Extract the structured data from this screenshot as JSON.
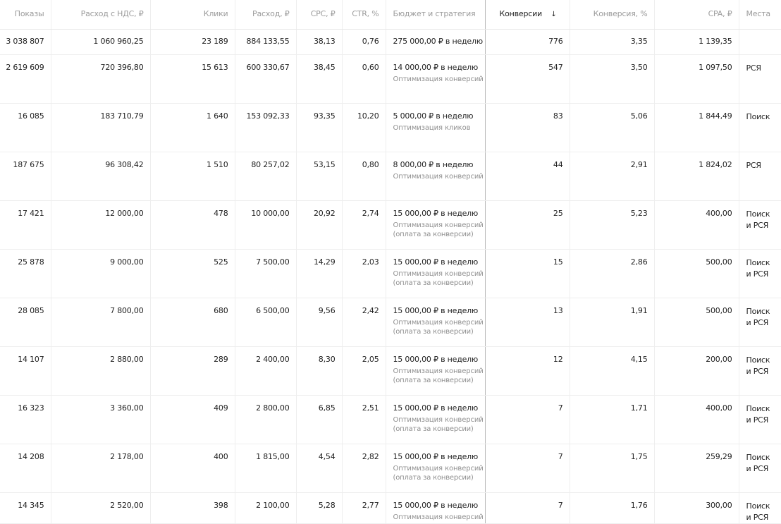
{
  "columns": [
    {
      "key": "impressions",
      "label": "Показы"
    },
    {
      "key": "cost_vat",
      "label": "Расход с НДС, ₽"
    },
    {
      "key": "clicks",
      "label": "Клики"
    },
    {
      "key": "cost",
      "label": "Расход, ₽"
    },
    {
      "key": "cpc",
      "label": "CPC, ₽"
    },
    {
      "key": "ctr",
      "label": "CTR, %"
    },
    {
      "key": "budget",
      "label": "Бюджет и стратегия"
    },
    {
      "key": "conversions",
      "label": "Конверсии",
      "sort_icon": "↓"
    },
    {
      "key": "conv_rate",
      "label": "Конверсия, %"
    },
    {
      "key": "cpa",
      "label": "CPA, ₽"
    },
    {
      "key": "places",
      "label": "Места"
    }
  ],
  "total": {
    "impressions": "3 038 807",
    "cost_vat": "1 060 960,25",
    "clicks": "23 189",
    "cost": "884 133,55",
    "cpc": "38,13",
    "ctr": "0,76",
    "budget": "275 000,00 ₽ в неделю",
    "conversions": "776",
    "conv_rate": "3,35",
    "cpa": "1 139,35"
  },
  "rows": [
    {
      "impressions": "2 619 609",
      "cost_vat": "720 396,80",
      "clicks": "15 613",
      "cost": "600 330,67",
      "cpc": "38,45",
      "ctr": "0,60",
      "budget": "14 000,00 ₽ в неделю",
      "strategy": "Оптимизация конверсий",
      "strategy_note": "",
      "conversions": "547",
      "conv_rate": "3,50",
      "cpa": "1 097,50",
      "places_1": "РСЯ",
      "places_2": ""
    },
    {
      "impressions": "16 085",
      "cost_vat": "183 710,79",
      "clicks": "1 640",
      "cost": "153 092,33",
      "cpc": "93,35",
      "ctr": "10,20",
      "budget": "5 000,00 ₽ в неделю",
      "strategy": "Оптимизация кликов",
      "strategy_note": "",
      "conversions": "83",
      "conv_rate": "5,06",
      "cpa": "1 844,49",
      "places_1": "Поиск",
      "places_2": ""
    },
    {
      "impressions": "187 675",
      "cost_vat": "96 308,42",
      "clicks": "1 510",
      "cost": "80 257,02",
      "cpc": "53,15",
      "ctr": "0,80",
      "budget": "8 000,00 ₽ в неделю",
      "strategy": "Оптимизация конверсий",
      "strategy_note": "",
      "conversions": "44",
      "conv_rate": "2,91",
      "cpa": "1 824,02",
      "places_1": "РСЯ",
      "places_2": ""
    },
    {
      "impressions": "17 421",
      "cost_vat": "12 000,00",
      "clicks": "478",
      "cost": "10 000,00",
      "cpc": "20,92",
      "ctr": "2,74",
      "budget": "15 000,00 ₽ в неделю",
      "strategy": "Оптимизация конверсий",
      "strategy_note": "(оплата за конверсии)",
      "conversions": "25",
      "conv_rate": "5,23",
      "cpa": "400,00",
      "places_1": "Поиск",
      "places_2": "и РСЯ"
    },
    {
      "impressions": "25 878",
      "cost_vat": "9 000,00",
      "clicks": "525",
      "cost": "7 500,00",
      "cpc": "14,29",
      "ctr": "2,03",
      "budget": "15 000,00 ₽ в неделю",
      "strategy": "Оптимизация конверсий",
      "strategy_note": "(оплата за конверсии)",
      "conversions": "15",
      "conv_rate": "2,86",
      "cpa": "500,00",
      "places_1": "Поиск",
      "places_2": "и РСЯ"
    },
    {
      "impressions": "28 085",
      "cost_vat": "7 800,00",
      "clicks": "680",
      "cost": "6 500,00",
      "cpc": "9,56",
      "ctr": "2,42",
      "budget": "15 000,00 ₽ в неделю",
      "strategy": "Оптимизация конверсий",
      "strategy_note": "(оплата за конверсии)",
      "conversions": "13",
      "conv_rate": "1,91",
      "cpa": "500,00",
      "places_1": "Поиск",
      "places_2": "и РСЯ"
    },
    {
      "impressions": "14 107",
      "cost_vat": "2 880,00",
      "clicks": "289",
      "cost": "2 400,00",
      "cpc": "8,30",
      "ctr": "2,05",
      "budget": "15 000,00 ₽ в неделю",
      "strategy": "Оптимизация конверсий",
      "strategy_note": "(оплата за конверсии)",
      "conversions": "12",
      "conv_rate": "4,15",
      "cpa": "200,00",
      "places_1": "Поиск",
      "places_2": "и РСЯ"
    },
    {
      "impressions": "16 323",
      "cost_vat": "3 360,00",
      "clicks": "409",
      "cost": "2 800,00",
      "cpc": "6,85",
      "ctr": "2,51",
      "budget": "15 000,00 ₽ в неделю",
      "strategy": "Оптимизация конверсий",
      "strategy_note": "(оплата за конверсии)",
      "conversions": "7",
      "conv_rate": "1,71",
      "cpa": "400,00",
      "places_1": "Поиск",
      "places_2": "и РСЯ"
    },
    {
      "impressions": "14 208",
      "cost_vat": "2 178,00",
      "clicks": "400",
      "cost": "1 815,00",
      "cpc": "4,54",
      "ctr": "2,82",
      "budget": "15 000,00 ₽ в неделю",
      "strategy": "Оптимизация конверсий",
      "strategy_note": "(оплата за конверсии)",
      "conversions": "7",
      "conv_rate": "1,75",
      "cpa": "259,29",
      "places_1": "Поиск",
      "places_2": "и РСЯ"
    },
    {
      "impressions": "14 345",
      "cost_vat": "2 520,00",
      "clicks": "398",
      "cost": "2 100,00",
      "cpc": "5,28",
      "ctr": "2,77",
      "budget": "15 000,00 ₽ в неделю",
      "strategy": "Оптимизация конверсий",
      "strategy_note": "",
      "conversions": "7",
      "conv_rate": "1,76",
      "cpa": "300,00",
      "places_1": "Поиск",
      "places_2": "и РСЯ"
    }
  ]
}
